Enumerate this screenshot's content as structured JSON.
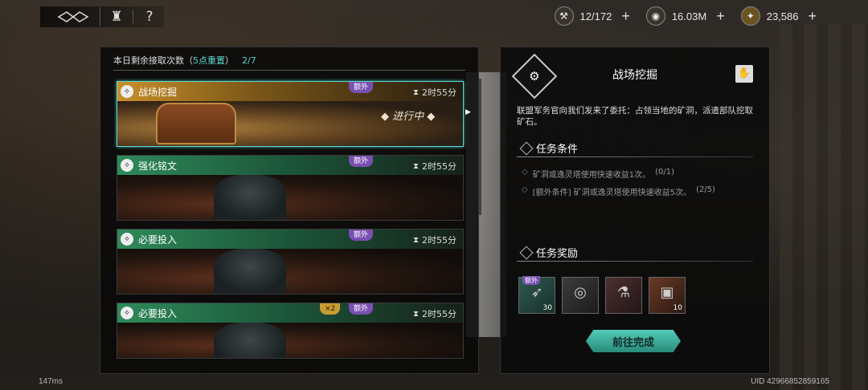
{
  "topbar": {
    "tower_icon": "tower-icon",
    "help_label": "?"
  },
  "resources": [
    {
      "icon": "stamina-icon",
      "value": "12/172"
    },
    {
      "icon": "silver-coin-icon",
      "value": "16.03M"
    },
    {
      "icon": "gold-coin-icon",
      "value": "23,586"
    }
  ],
  "left": {
    "count_prefix": "本日剩余接取次数（",
    "count_reset": "5点重置",
    "count_suffix": "）",
    "count_value": "2/7",
    "missions": [
      {
        "title": "战场挖掘",
        "extra": "额外",
        "time": "2时55分",
        "status": "进行中",
        "multiplier": ""
      },
      {
        "title": "强化铭文",
        "extra": "额外",
        "time": "2时55分",
        "status": "",
        "multiplier": ""
      },
      {
        "title": "必要投入",
        "extra": "额外",
        "time": "2时55分",
        "status": "",
        "multiplier": ""
      },
      {
        "title": "必要投入",
        "extra": "额外",
        "time": "2时55分",
        "status": "",
        "multiplier": "×2"
      }
    ]
  },
  "right": {
    "title": "战场挖掘",
    "description": "联盟军务官向我们发来了委托：占领当地的矿洞，派遣部队挖取矿石。",
    "conditions_title": "任务条件",
    "conditions": [
      {
        "text": "矿洞或逸灵塔使用快速收益1次。",
        "progress": "(0/1)"
      },
      {
        "text": "[额外条件] 矿洞或逸灵塔使用快速收益5次。",
        "progress": "(2/5)"
      }
    ],
    "rewards_title": "任务奖励",
    "rewards": [
      {
        "icon": "feather-icon",
        "qty": "30",
        "tag": "额外"
      },
      {
        "icon": "silver-coins-icon",
        "qty": "",
        "tag": ""
      },
      {
        "icon": "potion-icon",
        "qty": "",
        "tag": ""
      },
      {
        "icon": "cart-icon",
        "qty": "10",
        "tag": ""
      }
    ],
    "go_button": "前往完成"
  },
  "footer": {
    "latency": "147ms",
    "uid": "UID 42966852859165"
  },
  "colors": {
    "accent": "#5fd7d0",
    "extra_badge": "#7a4fb2",
    "multiplier_badge": "#c89c30"
  }
}
